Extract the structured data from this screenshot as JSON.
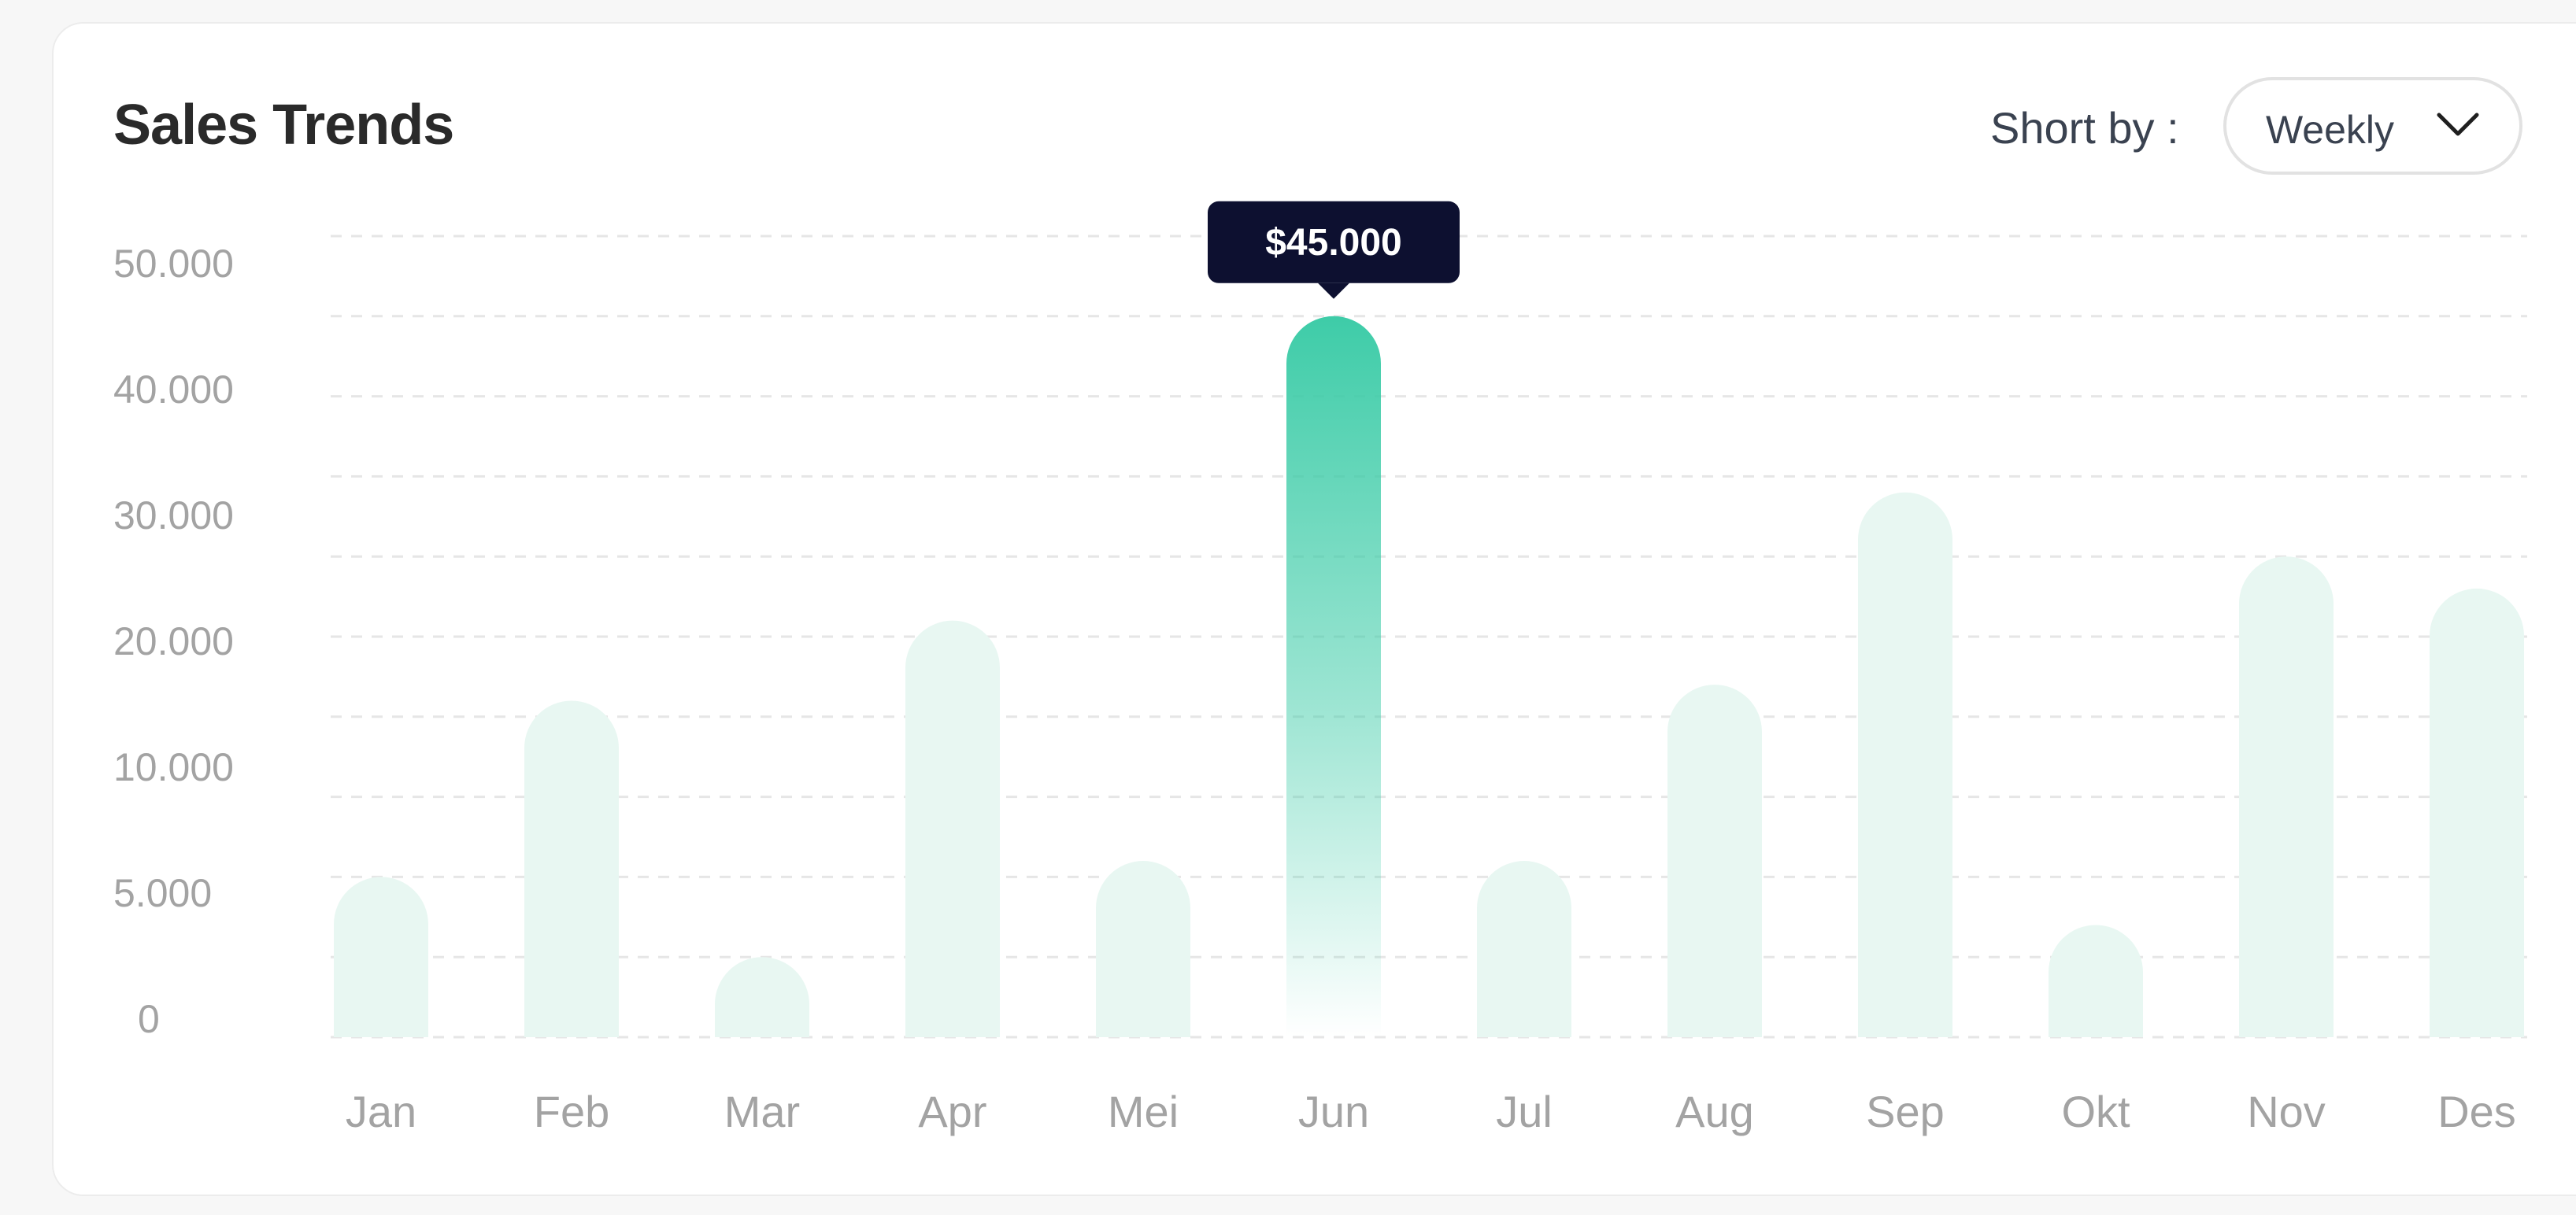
{
  "card": {
    "title": "Sales Trends"
  },
  "sort": {
    "label": "Short by :",
    "selected": "Weekly"
  },
  "tooltip": {
    "text": "$45.000"
  },
  "colors": {
    "bar_muted": "#e8f7f2",
    "bar_active_top": "#3ecca8",
    "tooltip_bg": "#0d1030",
    "tooltip_text": "#ffffff",
    "tick_text": "#a3a3a3",
    "grid": "#e6e6e6"
  },
  "chart_data": {
    "type": "bar",
    "title": "Sales Trends",
    "categories": [
      "Jan",
      "Feb",
      "Mar",
      "Apr",
      "Mei",
      "Jun",
      "Jul",
      "Aug",
      "Sep",
      "Okt",
      "Nov",
      "Des"
    ],
    "values": [
      10000,
      21000,
      5000,
      26000,
      11000,
      45000,
      11000,
      22000,
      34000,
      7000,
      30000,
      28000
    ],
    "highlighted_index": 5,
    "y_ticks": [
      {
        "value": 0,
        "label": "0"
      },
      {
        "value": 5000,
        "label": "5.000"
      },
      {
        "value": 10000,
        "label": "10.000"
      },
      {
        "value": 20000,
        "label": "20.000"
      },
      {
        "value": 30000,
        "label": "30.000"
      },
      {
        "value": 40000,
        "label": "40.000"
      },
      {
        "value": 50000,
        "label": "50.000"
      }
    ],
    "ylim": [
      0,
      50000
    ],
    "grid": true,
    "xlabel": "",
    "ylabel": ""
  }
}
